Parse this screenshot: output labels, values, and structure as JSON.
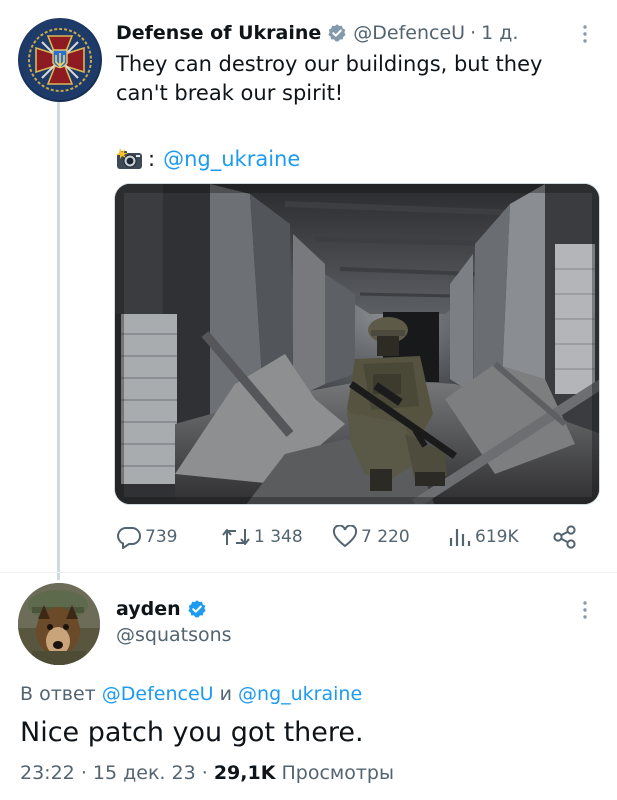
{
  "original_tweet": {
    "display_name": "Defense of Ukraine",
    "handle": "@DefenceU",
    "separator": "·",
    "time": "1 д.",
    "text": "They can destroy our buildings, but they can't break our spirit!",
    "credit_separator": ":",
    "credit_handle": "@ng_ukraine",
    "stats": {
      "replies": "739",
      "retweets": "1 348",
      "likes": "7 220",
      "views": "619K"
    }
  },
  "reply_tweet": {
    "display_name": "ayden",
    "handle": "@squatsons",
    "reply_prefix": "В ответ",
    "reply_to_1": "@DefenceU",
    "reply_conjunction": "и",
    "reply_to_2": "@ng_ukraine",
    "text": "Nice patch you got there.",
    "time": "23:22",
    "date": "15 дек. 23",
    "separator": "·",
    "views_count": "29,1K",
    "views_label": "Просмотры"
  },
  "colors": {
    "accent": "#1d9bf0",
    "secondary_text": "#536471",
    "primary_text": "#0f1419",
    "thread_line": "#cfd9de"
  },
  "icons": [
    "verified-badge-icon",
    "more-options-icon",
    "camera-flash-icon",
    "reply-icon",
    "retweet-icon",
    "like-icon",
    "views-icon",
    "share-icon"
  ]
}
